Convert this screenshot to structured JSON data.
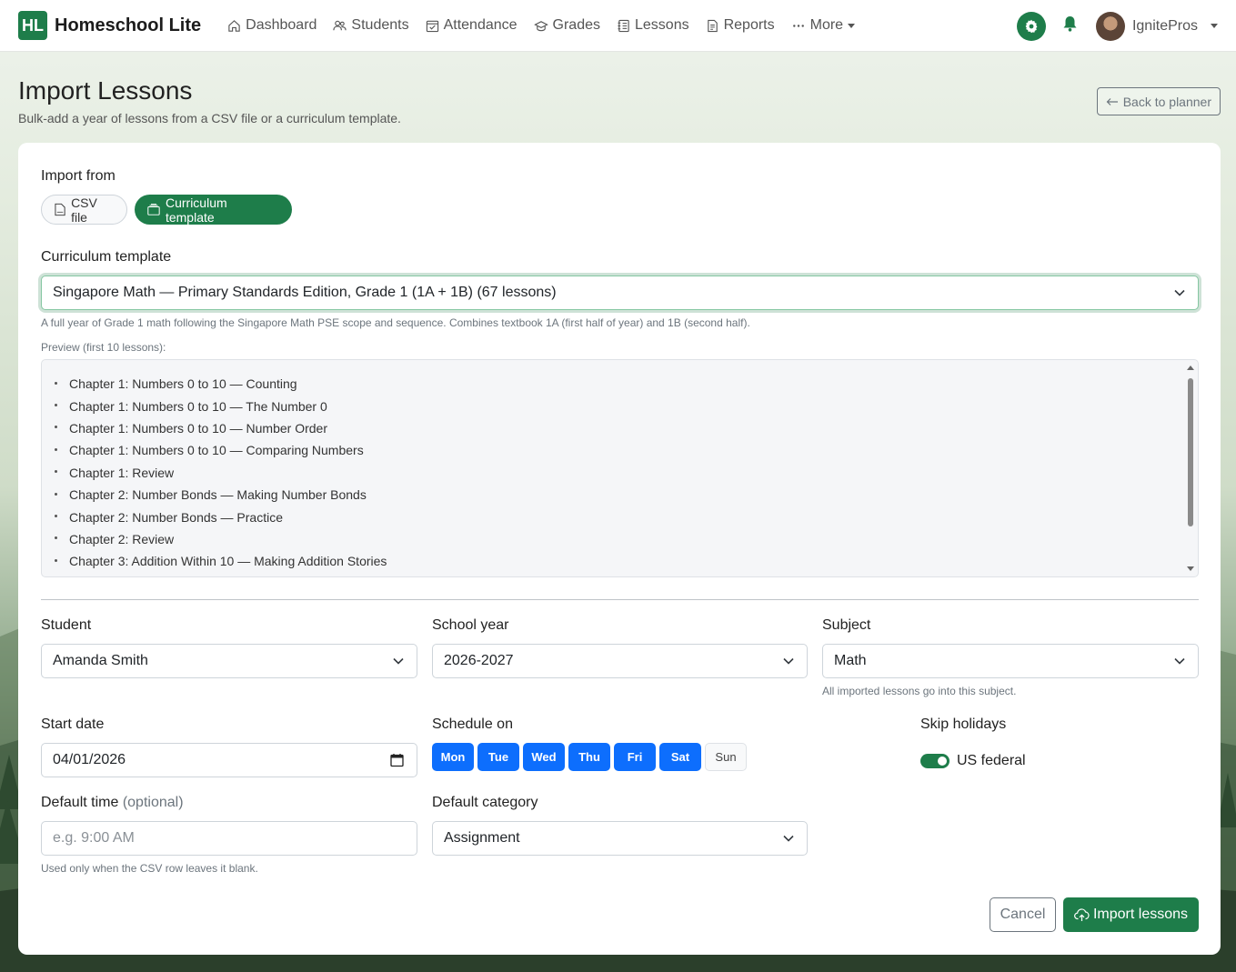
{
  "brand": {
    "logo": "HL",
    "name": "Homeschool Lite"
  },
  "nav": {
    "items": [
      {
        "label": "Dashboard",
        "icon": "house-icon"
      },
      {
        "label": "Students",
        "icon": "people-icon"
      },
      {
        "label": "Attendance",
        "icon": "calendar-check-icon"
      },
      {
        "label": "Grades",
        "icon": "mortarboard-icon"
      },
      {
        "label": "Lessons",
        "icon": "journal-icon"
      },
      {
        "label": "Reports",
        "icon": "file-text-icon"
      },
      {
        "label": "More",
        "icon": "three-dots-icon"
      }
    ],
    "user_name": "IgnitePros"
  },
  "header": {
    "title": "Import Lessons",
    "subtitle": "Bulk-add a year of lessons from a CSV file or a curriculum template.",
    "back_label": "Back to planner"
  },
  "form": {
    "import_from_label": "Import from",
    "source_options": {
      "csv": "CSV file",
      "template": "Curriculum template",
      "selected": "template"
    },
    "template_label": "Curriculum template",
    "template_value": "Singapore Math — Primary Standards Edition, Grade 1 (1A + 1B) (67 lessons)",
    "template_help": "A full year of Grade 1 math following the Singapore Math PSE scope and sequence. Combines textbook 1A (first half of year) and 1B (second half).",
    "preview_label": "Preview (first 10 lessons):",
    "preview_items": [
      "Chapter 1: Numbers 0 to 10 — Counting",
      "Chapter 1: Numbers 0 to 10 — The Number 0",
      "Chapter 1: Numbers 0 to 10 — Number Order",
      "Chapter 1: Numbers 0 to 10 — Comparing Numbers",
      "Chapter 1: Review",
      "Chapter 2: Number Bonds — Making Number Bonds",
      "Chapter 2: Number Bonds — Practice",
      "Chapter 2: Review",
      "Chapter 3: Addition Within 10 — Making Addition Stories"
    ],
    "student_label": "Student",
    "student_value": "Amanda Smith",
    "school_year_label": "School year",
    "school_year_value": "2026-2027",
    "subject_label": "Subject",
    "subject_value": "Math",
    "subject_help": "All imported lessons go into this subject.",
    "start_date_label": "Start date",
    "start_date_value": "04/01/2026",
    "schedule_label": "Schedule on",
    "days": [
      {
        "label": "Mon",
        "on": true
      },
      {
        "label": "Tue",
        "on": true
      },
      {
        "label": "Wed",
        "on": true
      },
      {
        "label": "Thu",
        "on": true
      },
      {
        "label": "Fri",
        "on": true
      },
      {
        "label": "Sat",
        "on": true
      },
      {
        "label": "Sun",
        "on": false
      }
    ],
    "skip_holidays_label": "Skip holidays",
    "holiday_toggle_label": "US federal",
    "holiday_toggle_on": true,
    "default_time_label": "Default time",
    "default_time_optional": "(optional)",
    "default_time_placeholder": "e.g. 9:00 AM",
    "default_time_help": "Used only when the CSV row leaves it blank.",
    "default_category_label": "Default category",
    "default_category_value": "Assignment",
    "cancel_label": "Cancel",
    "import_label": "Import lessons"
  },
  "colors": {
    "brand_green": "#1e7d4a",
    "day_blue": "#0d6efd"
  }
}
